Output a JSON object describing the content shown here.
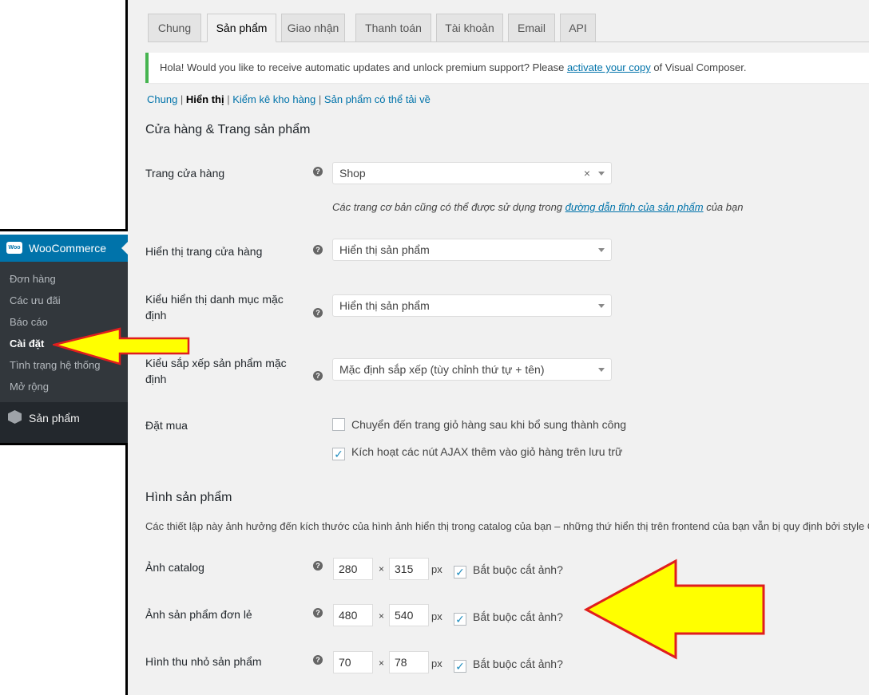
{
  "sidebar": {
    "woo_label": "WooCommerce",
    "woo_icon_text": "Woo",
    "items": [
      {
        "label": "Đơn hàng",
        "active": false
      },
      {
        "label": "Các ưu đãi",
        "active": false
      },
      {
        "label": "Báo cáo",
        "active": false
      },
      {
        "label": "Cài đặt",
        "active": true
      },
      {
        "label": "Tình trạng hệ thống",
        "active": false
      },
      {
        "label": "Mở rộng",
        "active": false
      }
    ],
    "products_label": "Sản phẩm"
  },
  "tabs": [
    {
      "label": "Chung",
      "active": false
    },
    {
      "label": "Sản phẩm",
      "active": true
    },
    {
      "label": "Giao nhận",
      "active": false
    },
    {
      "label": "Thanh toán",
      "active": false
    },
    {
      "label": "Tài khoản",
      "active": false
    },
    {
      "label": "Email",
      "active": false
    },
    {
      "label": "API",
      "active": false
    }
  ],
  "notice": {
    "text_before": "Hola! Would you like to receive automatic updates and unlock premium support? Please ",
    "link": "activate your copy",
    "text_after": " of Visual Composer."
  },
  "subsub": {
    "items": [
      "Chung",
      "Hiển thị",
      "Kiểm kê kho hàng",
      "Sản phẩm có thể tải về"
    ],
    "current": "Hiển thị",
    "sep1": " | ",
    "sep2": " |",
    "sep3": " |"
  },
  "shop_section": {
    "title": "Cửa hàng & Trang sản phẩm",
    "shop_page": {
      "label": "Trang cửa hàng",
      "value": "Shop",
      "clear": "×"
    },
    "shop_desc_before": "Các trang cơ bản cũng có thể được sử dụng trong ",
    "shop_desc_link": "đường dẫn tĩnh của sản phẩm",
    "shop_desc_after": " của bạn",
    "shop_display": {
      "label": "Hiển thị trang cửa hàng",
      "value": "Hiển thị sản phẩm"
    },
    "category_display": {
      "label_line1": "Kiểu hiển thị danh mục mặc",
      "label_line2": "định",
      "value": "Hiển thị sản phẩm"
    },
    "sorting": {
      "label_line1": "Kiểu sắp xếp sản phẩm mặc",
      "label_line2": "định",
      "value": "Mặc định sắp xếp (tùy chỉnh thứ tự + tên)"
    },
    "add_to_cart": {
      "label": "Đặt mua",
      "options": [
        {
          "label": "Chuyển đến trang giỏ hàng sau khi bổ sung thành công",
          "checked": false
        },
        {
          "label": "Kích hoạt các nút AJAX thêm vào giỏ hàng trên lưu trữ",
          "checked": true
        }
      ]
    }
  },
  "image_section": {
    "title": "Hình sản phẩm",
    "desc": "Các thiết lập này ảnh hưởng đến kích thước của hình ảnh hiển thị trong catalog của bạn – những thứ hiển thị trên frontend của bạn vẫn bị quy định bởi style C",
    "times": "×",
    "px": "px",
    "crop_label": "Bắt buộc cắt ảnh?",
    "rows": [
      {
        "label": "Ảnh catalog",
        "width": "280",
        "height": "315",
        "crop": true
      },
      {
        "label": "Ảnh sản phẩm đơn lẻ",
        "width": "480",
        "height": "540",
        "crop": true
      },
      {
        "label": "Hình thu nhỏ sản phẩm",
        "width": "70",
        "height": "78",
        "crop": true
      }
    ]
  },
  "help_glyph": "?",
  "check_glyph": "✓",
  "colors": {
    "accent": "#0073aa",
    "notice_border": "#46b450",
    "arrow_fill": "#ffff00",
    "arrow_stroke": "#e01e1e"
  }
}
